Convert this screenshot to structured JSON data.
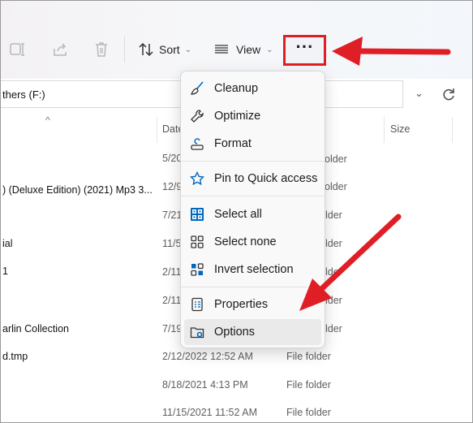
{
  "toolbar": {
    "sort_label": "Sort",
    "view_label": "View",
    "more_label": "···",
    "icons": [
      "rename-icon",
      "share-icon",
      "delete-icon",
      "sort-icon",
      "view-icon",
      "see-more-icon"
    ]
  },
  "address": {
    "path": "thers (F:)"
  },
  "columns": {
    "date": "Date",
    "size": "Size"
  },
  "rows": [
    {
      "name": "",
      "date": "5/20",
      "type": ""
    },
    {
      "name": ") (Deluxe Edition) (2021) Mp3 3...",
      "date": "12/9",
      "type": ""
    },
    {
      "name": "",
      "date": "7/21",
      "type": ""
    },
    {
      "name": "ial",
      "date": "11/5",
      "type": ""
    },
    {
      "name": "1",
      "date": "2/11",
      "type": ""
    },
    {
      "name": "",
      "date": "2/11",
      "type": ""
    },
    {
      "name": "arlin Collection",
      "date": "7/19",
      "type": ""
    },
    {
      "name": "d.tmp",
      "date": "2/12/2022 12:52 AM",
      "type": "File folder"
    },
    {
      "name": "",
      "date": "8/18/2021 4:13 PM",
      "type": "File folder"
    },
    {
      "name": "",
      "date": "11/15/2021 11:52 AM",
      "type": "File folder"
    }
  ],
  "partial_type_text": [
    "older",
    "older",
    "lder",
    "lder",
    "lder",
    "lder",
    "lder"
  ],
  "menu": {
    "items": [
      {
        "label": "Cleanup",
        "icon": "broom-icon"
      },
      {
        "label": "Optimize",
        "icon": "wrench-icon"
      },
      {
        "label": "Format",
        "icon": "format-drive-icon"
      },
      {
        "label": "Pin to Quick access",
        "icon": "star-icon"
      },
      {
        "label": "Select all",
        "icon": "select-all-icon"
      },
      {
        "label": "Select none",
        "icon": "select-none-icon"
      },
      {
        "label": "Invert selection",
        "icon": "invert-selection-icon"
      },
      {
        "label": "Properties",
        "icon": "properties-icon"
      },
      {
        "label": "Options",
        "icon": "options-icon"
      }
    ]
  },
  "colors": {
    "highlight_red": "#e01e26",
    "accent_blue": "#0067c0"
  }
}
